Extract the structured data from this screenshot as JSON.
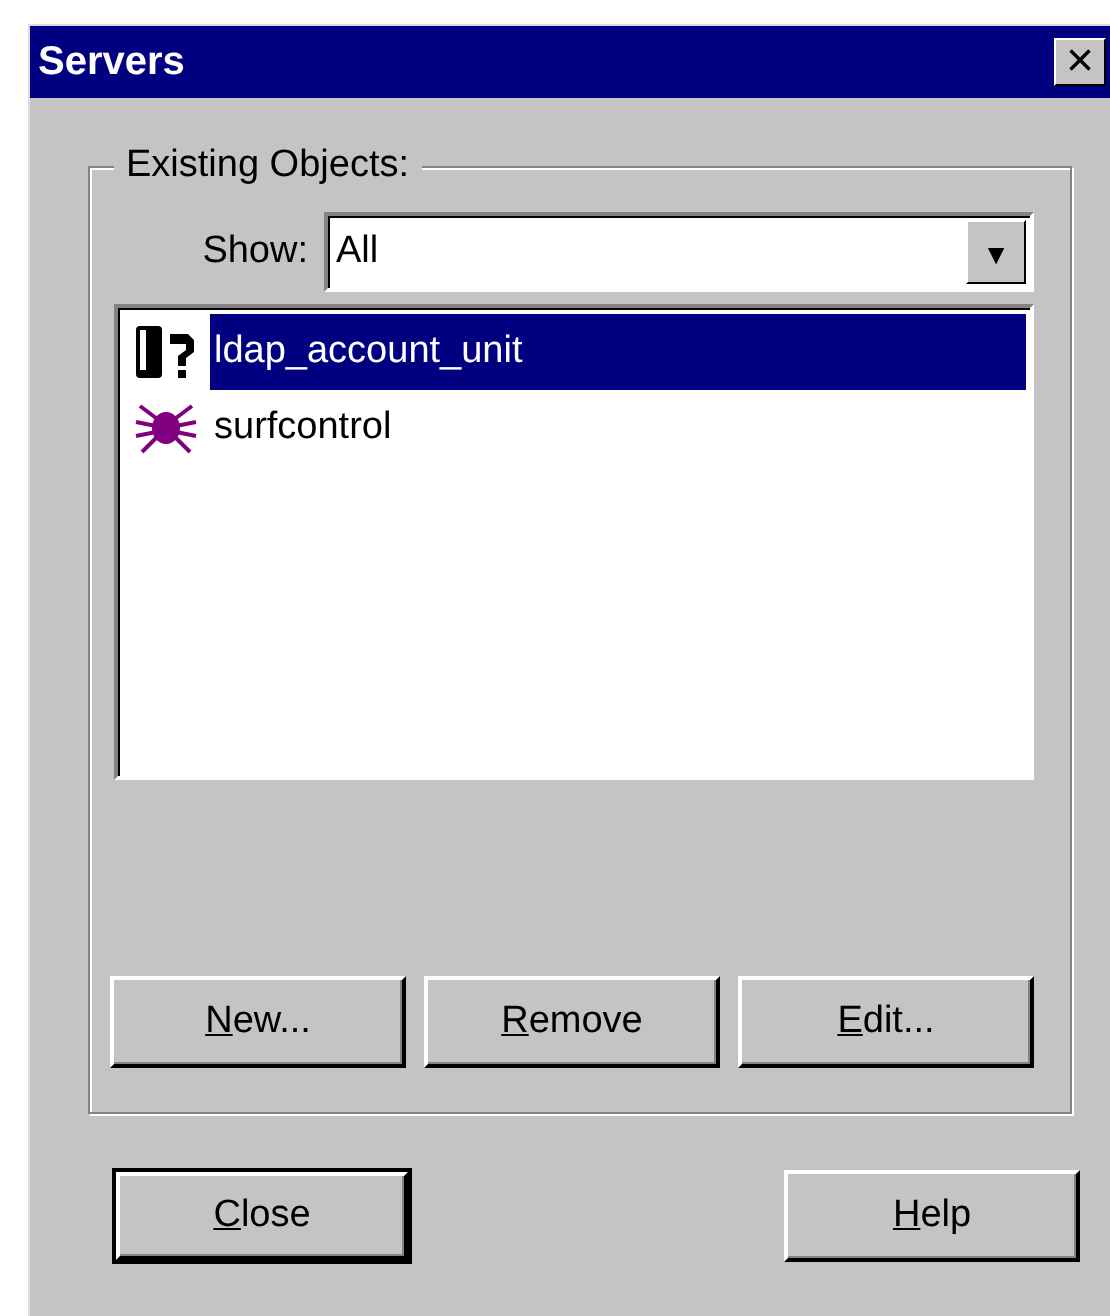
{
  "window": {
    "title": "Servers",
    "close_glyph": "×"
  },
  "group": {
    "label": "Existing Objects:",
    "show": {
      "label": "Show:",
      "value": "All",
      "arrow": "▼"
    },
    "items": [
      {
        "label": "ldap_account_unit",
        "kind": "server",
        "selected": true
      },
      {
        "label": "surfcontrol",
        "kind": "spider",
        "selected": false
      }
    ],
    "buttons": [
      {
        "key": "N",
        "rest": "ew...",
        "default": false
      },
      {
        "key": "R",
        "rest": "emove",
        "default": false
      },
      {
        "key": "E",
        "rest": "dit...",
        "default": false
      }
    ]
  },
  "footer_buttons": [
    {
      "key": "C",
      "rest": "lose",
      "default": true
    },
    {
      "key": "H",
      "rest": "elp",
      "default": false
    }
  ]
}
